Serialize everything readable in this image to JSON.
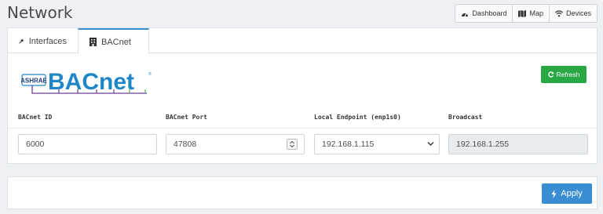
{
  "page": {
    "title": "Network"
  },
  "topnav": [
    {
      "label": "Dashboard",
      "icon": "dashboard-icon"
    },
    {
      "label": "Map",
      "icon": "map-icon"
    },
    {
      "label": "Devices",
      "icon": "wifi-icon"
    }
  ],
  "tabs": [
    {
      "label": "Interfaces",
      "icon": "plug-icon",
      "active": false
    },
    {
      "label": "BACnet",
      "icon": "building-icon",
      "active": true
    }
  ],
  "logo": {
    "brand": "BACnet",
    "org": "ASHRAE",
    "mark": "®",
    "colors": {
      "text": "#1f86c8",
      "green": "#52b948",
      "purple": "#6a3f96"
    }
  },
  "refresh_button": {
    "label": "Refresh",
    "icon": "refresh-icon",
    "color": "#28a745"
  },
  "fields": {
    "bacnet_id": {
      "label": "BACnet ID",
      "value": "6000"
    },
    "bacnet_port": {
      "label": "BACnet Port",
      "value": "47808"
    },
    "local_endpoint": {
      "label": "Local Endpoint (enp1s0)",
      "value": "192.168.1.115"
    },
    "broadcast": {
      "label": "Broadcast",
      "value": "192.168.1.255"
    }
  },
  "apply_button": {
    "label": "Apply",
    "icon": "bolt-icon",
    "color": "#3a8dd1"
  }
}
